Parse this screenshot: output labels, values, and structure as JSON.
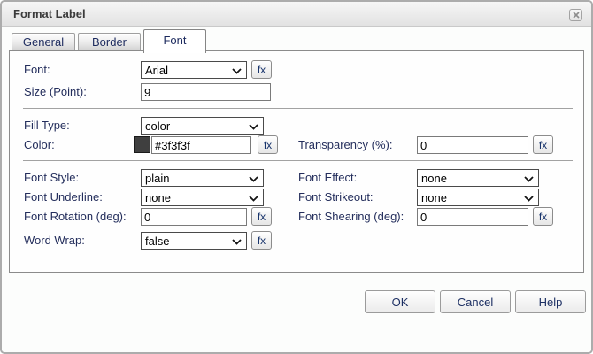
{
  "dialog": {
    "title": "Format Label"
  },
  "tabs": {
    "general": "General",
    "border": "Border",
    "font": "Font"
  },
  "fields": {
    "font": {
      "label": "Font:",
      "value": "Arial"
    },
    "size": {
      "label": "Size (Point):",
      "value": "9"
    },
    "fill_type": {
      "label": "Fill Type:",
      "value": "color"
    },
    "color": {
      "label": "Color:",
      "value": "#3f3f3f",
      "swatch_color": "#3f3f3f"
    },
    "transparency": {
      "label": "Transparency (%):",
      "value": "0"
    },
    "font_style": {
      "label": "Font Style:",
      "value": "plain"
    },
    "font_effect": {
      "label": "Font Effect:",
      "value": "none"
    },
    "font_underline": {
      "label": "Font Underline:",
      "value": "none"
    },
    "font_strikeout": {
      "label": "Font Strikeout:",
      "value": "none"
    },
    "font_rotation": {
      "label": "Font Rotation (deg):",
      "value": "0"
    },
    "font_shearing": {
      "label": "Font Shearing (deg):",
      "value": "0"
    },
    "word_wrap": {
      "label": "Word Wrap:",
      "value": "false"
    }
  },
  "fx_button_label": "fx",
  "buttons": {
    "ok": "OK",
    "cancel": "Cancel",
    "help": "Help"
  },
  "colors": {
    "swatch": "#3f3f3f",
    "label_text": "#242e5c",
    "accent_text": "#17336b",
    "titlebar_text": "#3b3b3b"
  }
}
